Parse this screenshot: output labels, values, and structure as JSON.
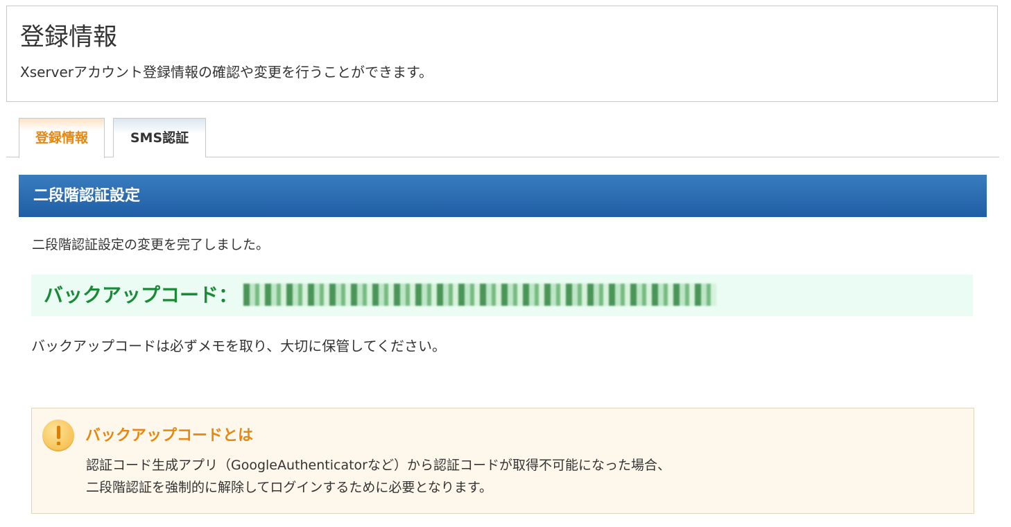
{
  "header": {
    "title": "登録情報",
    "description": "Xserverアカウント登録情報の確認や変更を行うことができます。"
  },
  "tabs": [
    {
      "label": "登録情報",
      "active": true
    },
    {
      "label": "SMS認証",
      "active": false
    }
  ],
  "section": {
    "title": "二段階認証設定",
    "complete_message": "二段階認証設定の変更を完了しました。",
    "backup_label": "バックアップコード：",
    "backup_code_state": "blurred",
    "memo_message": "バックアップコードは必ずメモを取り、大切に保管してください。"
  },
  "info": {
    "icon": "exclamation-icon",
    "title": "バックアップコードとは",
    "line1": "認証コード生成アプリ（GoogleAuthenticatorなど）から認証コードが取得不可能になった場合、",
    "line2": "二段階認証を強制的に解除してログインするために必要となります。"
  },
  "colors": {
    "accent_orange": "#e8870f",
    "header_blue": "#1f5ea4",
    "code_green": "#1a8a36",
    "code_bg": "#eafcf3",
    "info_bg": "#fef8ec"
  }
}
